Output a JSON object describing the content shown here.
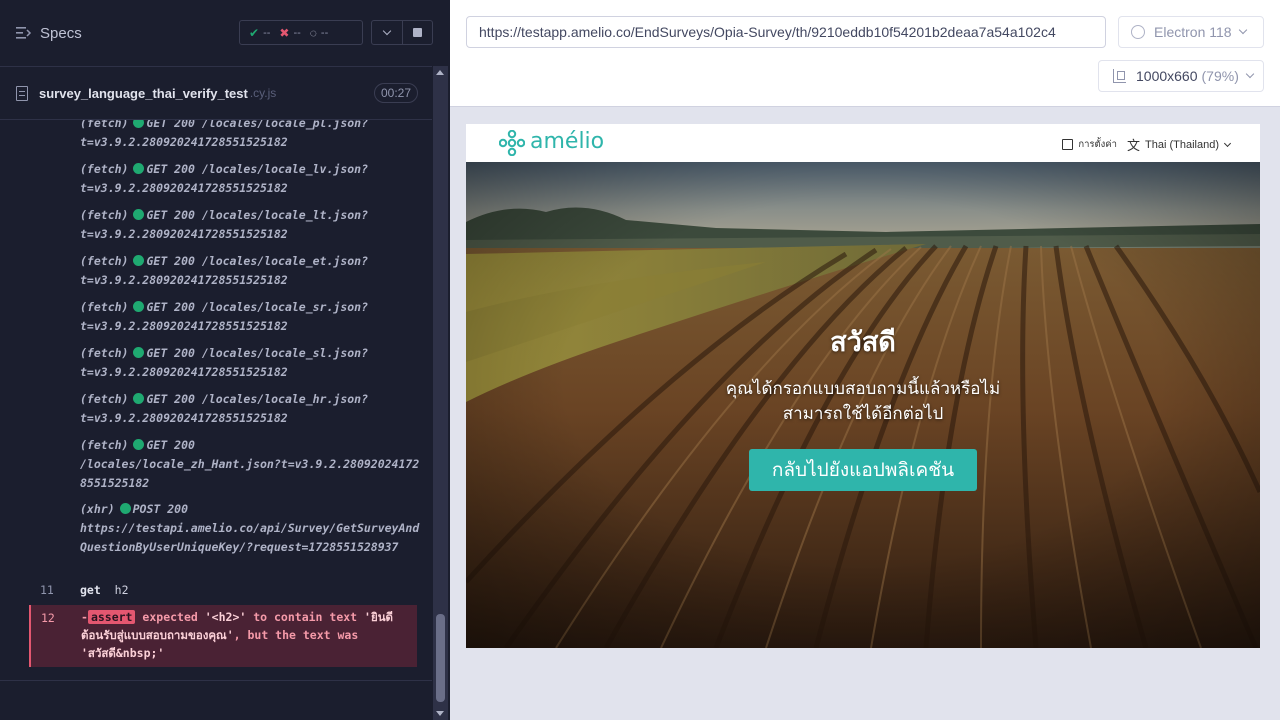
{
  "reporter": {
    "header": {
      "specs_label": "Specs"
    },
    "stats": {
      "passed": "--",
      "failed": "--",
      "pending": "--"
    },
    "spec": {
      "name": "survey_language_thai_verify_test",
      "ext": ".cy.js",
      "duration": "00:27"
    },
    "log": [
      {
        "kind": "(fetch)",
        "msg": "GET 200 /locales/locale_pl.json?",
        "url": "t=v3.9.2.28092024172855152518​2"
      },
      {
        "kind": "(fetch)",
        "msg": "GET 200 /locales/locale_lv.json?",
        "url": "t=v3.9.2.280920241728551525182"
      },
      {
        "kind": "(fetch)",
        "msg": "GET 200 /locales/locale_lt.json?",
        "url": "t=v3.9.2.280920241728551525182"
      },
      {
        "kind": "(fetch)",
        "msg": "GET 200 /locales/locale_et.json?",
        "url": "t=v3.9.2.280920241728551525182"
      },
      {
        "kind": "(fetch)",
        "msg": "GET 200 /locales/locale_sr.json?",
        "url": "t=v3.9.2.280920241728551525182"
      },
      {
        "kind": "(fetch)",
        "msg": "GET 200 /locales/locale_sl.json?",
        "url": "t=v3.9.2.280920241728551525182"
      },
      {
        "kind": "(fetch)",
        "msg": "GET 200 /locales/locale_hr.json?",
        "url": "t=v3.9.2.280920241728551525182"
      },
      {
        "kind": "(fetch)",
        "msg": "GET 200",
        "url": "/locales/locale_zh_Hant.json?t=v3.9.2.280920241728551525182"
      },
      {
        "kind": "(xhr)",
        "msg": "POST 200",
        "url": "https://testapi.amelio.co/api/Survey/GetSurveyAndQuestionByUserUniqueKey/?request=1728551528937"
      }
    ],
    "get_step": {
      "line": "11",
      "command": "get",
      "arg": "h2"
    },
    "assert_step": {
      "line": "12",
      "prefix": "-",
      "badge": "assert",
      "text1": "expected",
      "selector": "'<h2>'",
      "text2": "to contain text",
      "expected": "'ยินดีต้อนรับสู่แบบสอบถามของคุณ'",
      "text3": ", but the text was",
      "actual": "'สวัสดี&nbsp;'"
    }
  },
  "aut": {
    "url": "https://testapp.amelio.co/EndSurveys/Opia-Survey/th/9210eddb10f54201b2deaa7a54a102c4",
    "browser": "Electron 118",
    "viewport": "1000x660",
    "scale": "(79%)"
  },
  "app": {
    "logo": "amélio",
    "settings_label": "การตั้งค่า",
    "language": "Thai (Thailand)",
    "hero": {
      "title": "สวัสดี",
      "subtitle": "คุณได้กรอกแบบสอบถามนี้แล้วหรือไม่สามารถใช้ได้อีกต่อไป",
      "button": "กลับไปยังแอปพลิเคชัน"
    }
  },
  "colors": {
    "brand": "#2fb5ab",
    "pass": "#1fa971",
    "fail": "#e45770",
    "reporter_bg": "#1b1e2e"
  }
}
